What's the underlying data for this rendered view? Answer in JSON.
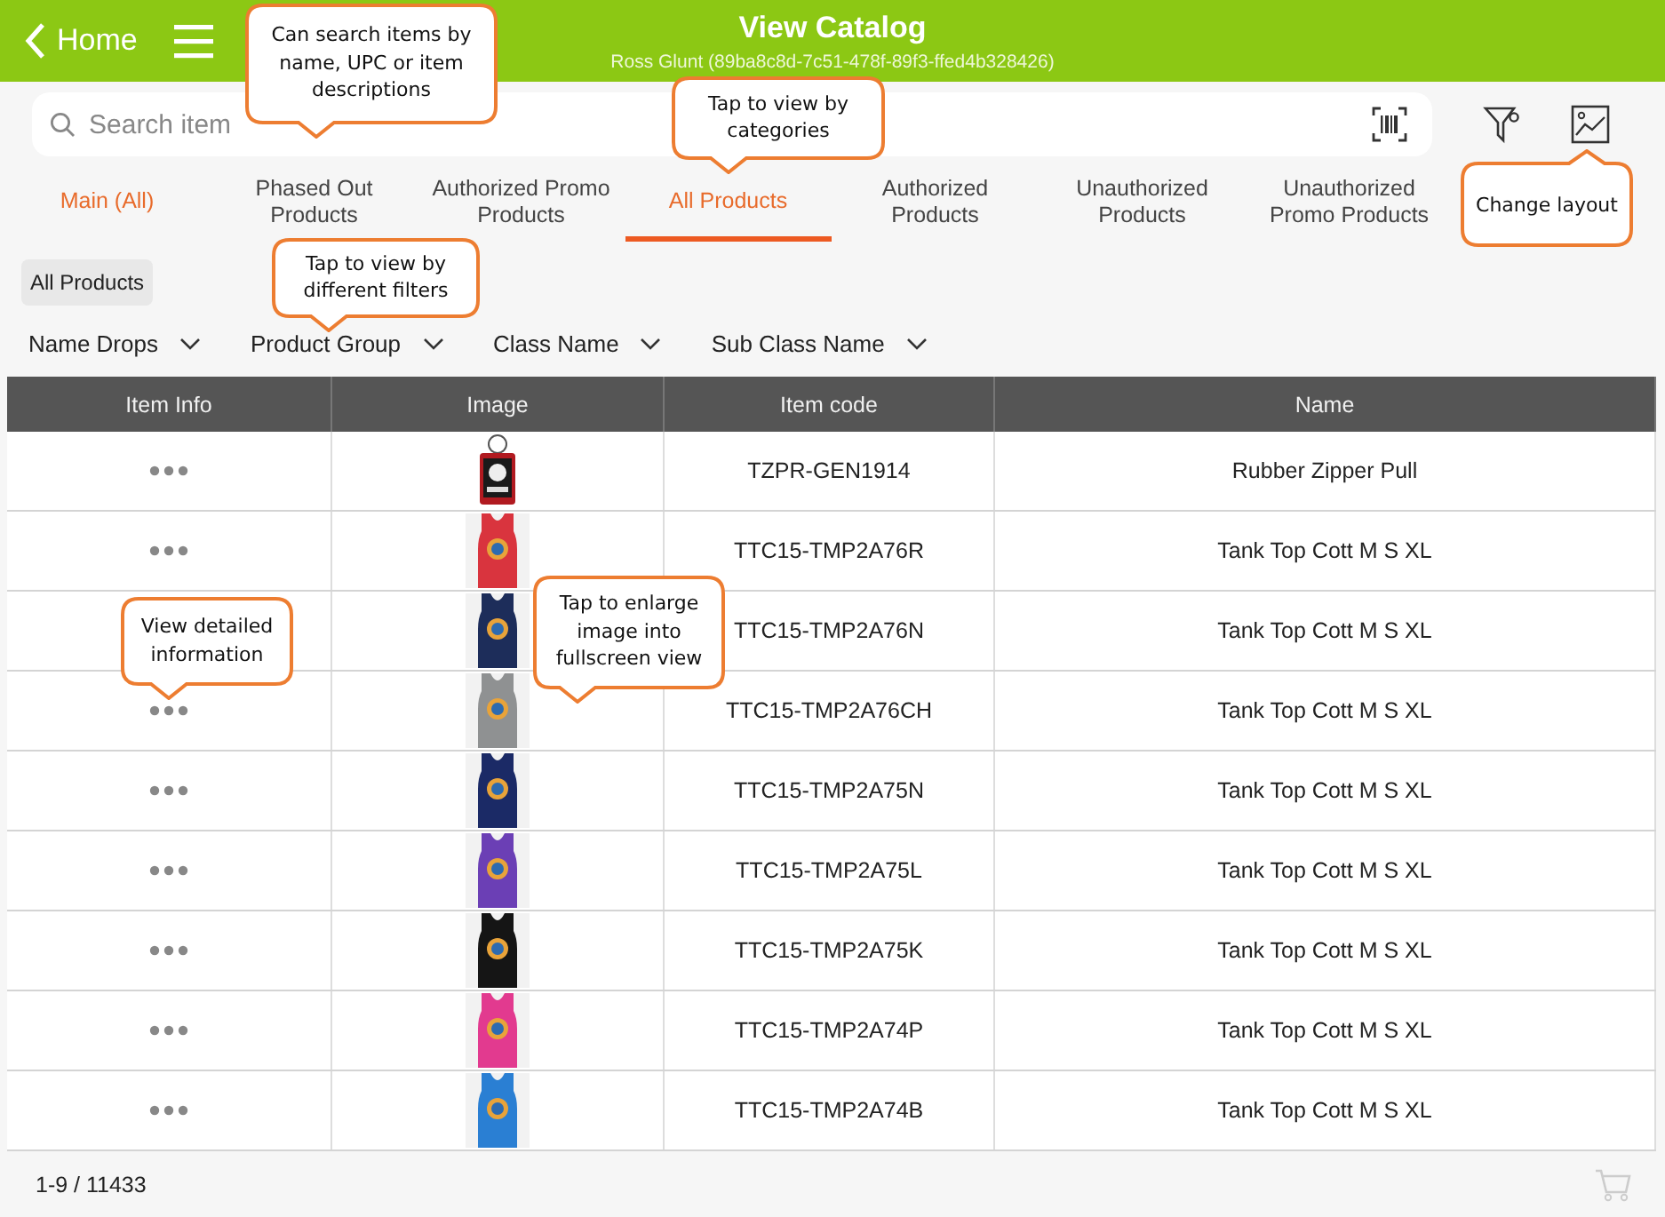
{
  "header": {
    "back_label": "Home",
    "title": "View Catalog",
    "subtitle": "Ross Glunt (89ba8c8d-7c51-478f-89f3-ffed4b328426)"
  },
  "search": {
    "placeholder": "Search item"
  },
  "tabs": [
    {
      "label": "Main (All)",
      "selected": false,
      "kind": "main"
    },
    {
      "label": "Phased Out Products",
      "selected": false,
      "kind": "normal"
    },
    {
      "label": "Authorized Promo Products",
      "selected": false,
      "kind": "normal"
    },
    {
      "label": "All Products",
      "selected": true,
      "kind": "normal"
    },
    {
      "label": "Authorized Products",
      "selected": false,
      "kind": "normal"
    },
    {
      "label": "Unauthorized Products",
      "selected": false,
      "kind": "normal"
    },
    {
      "label": "Unauthorized Promo Products",
      "selected": false,
      "kind": "normal"
    }
  ],
  "chip": {
    "label": "All Products"
  },
  "filters": [
    "Name Drops",
    "Product Group",
    "Class Name",
    "Sub Class Name"
  ],
  "table": {
    "columns": [
      "Item Info",
      "Image",
      "Item code",
      "Name"
    ],
    "rows": [
      {
        "show_info": true,
        "item_code": "TZPR-GEN1914",
        "name": "Rubber Zipper Pull"
      },
      {
        "show_info": true,
        "item_code": "TTC15-TMP2A76R",
        "name": "Tank Top Cott M S XL"
      },
      {
        "show_info": false,
        "item_code": "TTC15-TMP2A76N",
        "name": "Tank Top Cott M S XL"
      },
      {
        "show_info": true,
        "item_code": "TTC15-TMP2A76CH",
        "name": "Tank Top Cott M S XL"
      },
      {
        "show_info": true,
        "item_code": "TTC15-TMP2A75N",
        "name": "Tank Top Cott M S XL"
      },
      {
        "show_info": true,
        "item_code": "TTC15-TMP2A75L",
        "name": "Tank Top Cott M S XL"
      },
      {
        "show_info": true,
        "item_code": "TTC15-TMP2A75K",
        "name": "Tank Top Cott M S XL"
      },
      {
        "show_info": true,
        "item_code": "TTC15-TMP2A74P",
        "name": "Tank Top Cott M S XL"
      },
      {
        "show_info": true,
        "item_code": "TTC15-TMP2A74B",
        "name": "Tank Top Cott M S XL"
      }
    ]
  },
  "footer": {
    "count": "1-9 / 11433"
  },
  "callouts": [
    "Can search items by name, UPC or item descriptions",
    "Tap to view by categories",
    "Change layout",
    "Tap to view by different filters",
    "View detailed information",
    "Tap to enlarge image into fullscreen view"
  ]
}
